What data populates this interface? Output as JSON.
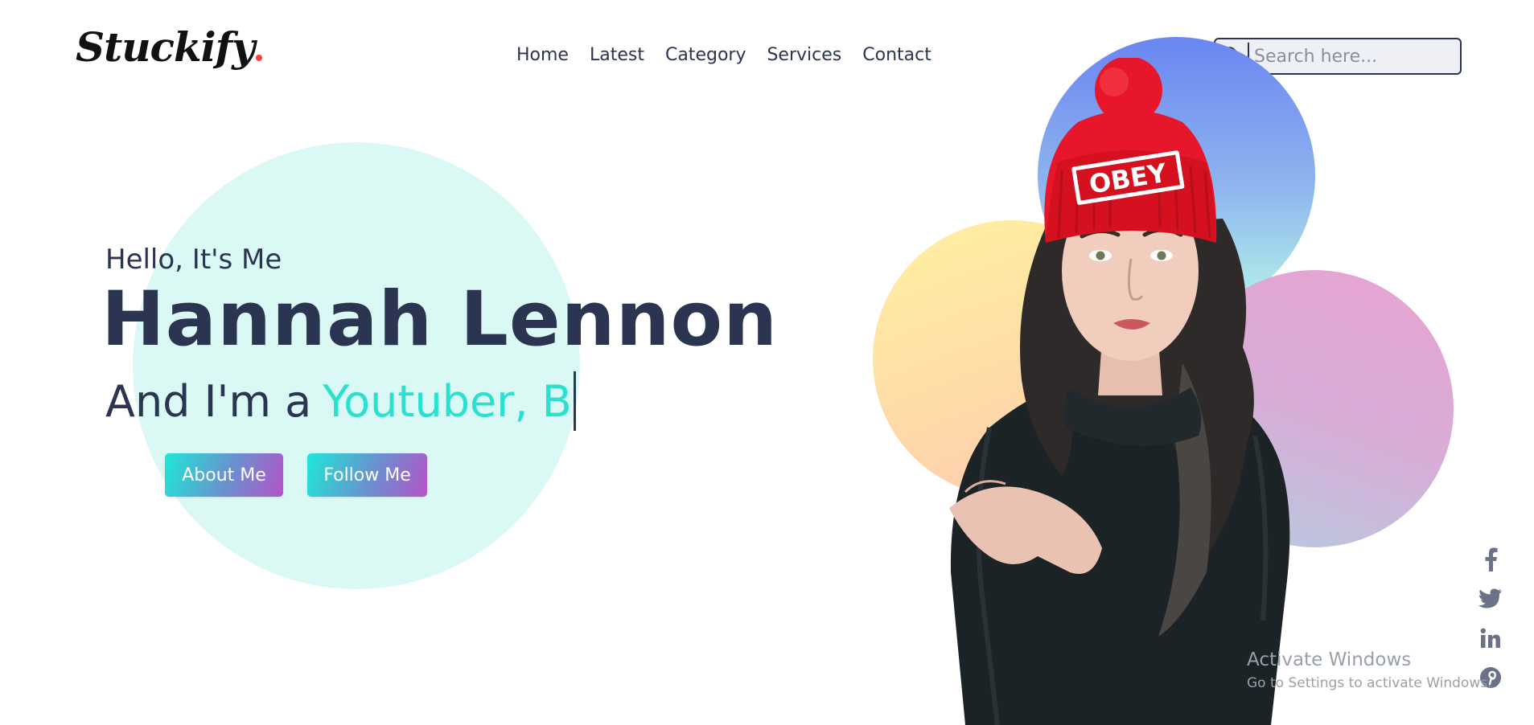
{
  "brand": {
    "name": "Stuckify",
    "dot_color": "#ff3b3b"
  },
  "nav": {
    "items": [
      {
        "label": "Home"
      },
      {
        "label": "Latest"
      },
      {
        "label": "Category"
      },
      {
        "label": "Services"
      },
      {
        "label": "Contact"
      }
    ]
  },
  "search": {
    "placeholder": "Search here...",
    "value": "",
    "icon": "search-icon"
  },
  "hero": {
    "greeting": "Hello, It's Me",
    "name": "Hannah Lennon",
    "role_prefix": "And I'm a",
    "role_typed": "Youtuber, B",
    "buttons": [
      {
        "label": "About Me"
      },
      {
        "label": "Follow Me"
      }
    ]
  },
  "portrait": {
    "hat_text": "OBEY"
  },
  "social": {
    "icons": [
      "facebook-icon",
      "twitter-icon",
      "linkedin-icon",
      "pinterest-icon"
    ]
  },
  "watermark": {
    "title": "Activate Windows",
    "subtitle": "Go to Settings to activate Windows."
  },
  "colors": {
    "text": "#2b3450",
    "accent": "#2ae0cf",
    "hero_circle": "#daf8f4",
    "button_gradient_start": "#1ee8d6",
    "button_gradient_end": "#b453c8"
  }
}
